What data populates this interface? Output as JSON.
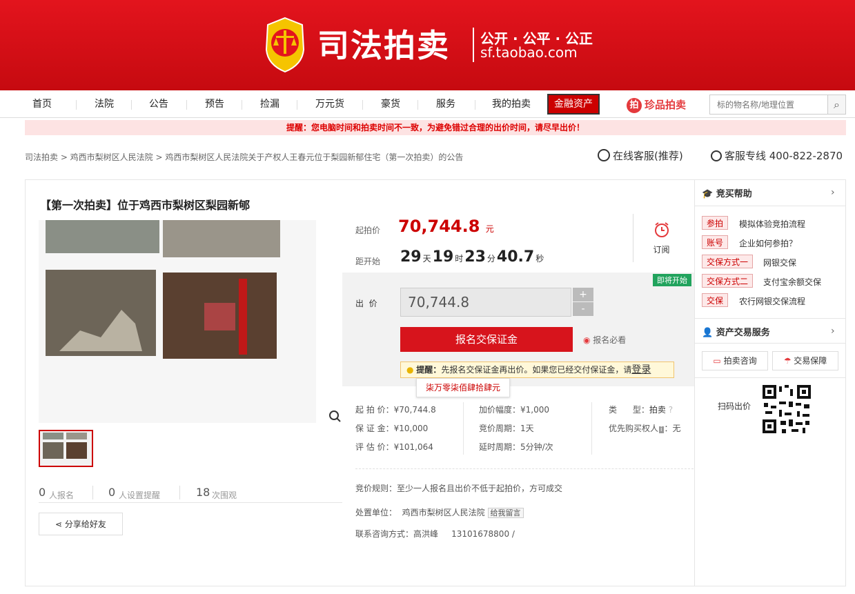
{
  "header": {
    "title": "司法拍卖",
    "slogan": "公开 · 公平 · 公正",
    "domain": "sf.taobao.com"
  },
  "nav": {
    "items": [
      "首页",
      "法院",
      "公告",
      "预告",
      "捡漏",
      "万元货",
      "豪货",
      "服务",
      "我的拍卖"
    ],
    "finance": "金融资产",
    "zhenpin": "珍品拍卖",
    "zhenpin_icon": "拍",
    "search_placeholder": "标的物名称/地理位置"
  },
  "notice": "提醒：您电脑时间和拍卖时间不一致，为避免错过合理的出价时间，请尽早出价！",
  "breadcrumb": "司法拍卖 > 鸡西市梨树区人民法院 > 鸡西市梨树区人民法院关于产权人王春元位于梨园新郁住宅（第一次拍卖）的公告",
  "service": {
    "online": "在线客服(推荐)",
    "hotline": "客服专线 400-822-2870"
  },
  "lot": {
    "title": "【第一次拍卖】位于鸡西市梨树区梨园新郇",
    "start_label": "起拍价",
    "start_price": "70,744.8",
    "unit": "元",
    "countdown_label": "距开始",
    "days": "29",
    "d": "天",
    "hours": "19",
    "h": "时",
    "mins": "23",
    "m": "分",
    "secs": "40.7",
    "s": "秒",
    "subscribe": "订阅",
    "badge": "即将开始",
    "bid_label": "出  价",
    "bid_value": "70,744.8",
    "plus": "+",
    "minus": "-",
    "enroll": "报名交保证金",
    "enroll_notice": "报名必看",
    "tip_prefix": "提醒：",
    "tip": "先报名交保证金再出价。如果您已经交付保证金，请",
    "tip_link": "登录",
    "tooltip": "柒万零柒佰肆拾肆元"
  },
  "details": {
    "start": "起 拍 价：¥70,744.8",
    "deposit": "保 证 金：¥10,000",
    "estimate": "评 估 价：¥101,064",
    "increment": "加价幅度：¥1,000",
    "cycle": "竞价周期：1天",
    "delay": "延时周期：5分钟/次",
    "type_label": "类      型：",
    "type": "拍卖",
    "priority": "优先购买权人",
    "priority_value": "：无"
  },
  "rules": {
    "rule": "竞价规则：至少一人报名且出价不低于起拍价，方可成交",
    "unit_label": "处置单位：",
    "unit": "鸡西市梨树区人民法院",
    "leave_msg": "给我留言",
    "contact": "联系咨询方式：高洪峰",
    "phone": "13101678800 /"
  },
  "stats": {
    "enroll_n": "0",
    "enroll_t": "人报名",
    "remind_n": "0",
    "remind_t": "人设置提醒",
    "view_n": "18",
    "view_t": "次围观"
  },
  "share": "分享给好友",
  "help": {
    "title": "竞买帮助",
    "items": [
      {
        "tag": "参拍",
        "text": "模拟体验竞拍流程"
      },
      {
        "tag": "账号",
        "text": "企业如何参拍？"
      },
      {
        "tag": "交保方式一",
        "text": "网银交保"
      },
      {
        "tag": "交保方式二",
        "text": "支付宝余额交保"
      },
      {
        "tag": "交保",
        "text": "农行网银交保流程"
      }
    ]
  },
  "asset": {
    "title": "资产交易服务",
    "consult": "拍卖咨询",
    "guarantee": "交易保障",
    "qr_label": "扫码出价"
  }
}
